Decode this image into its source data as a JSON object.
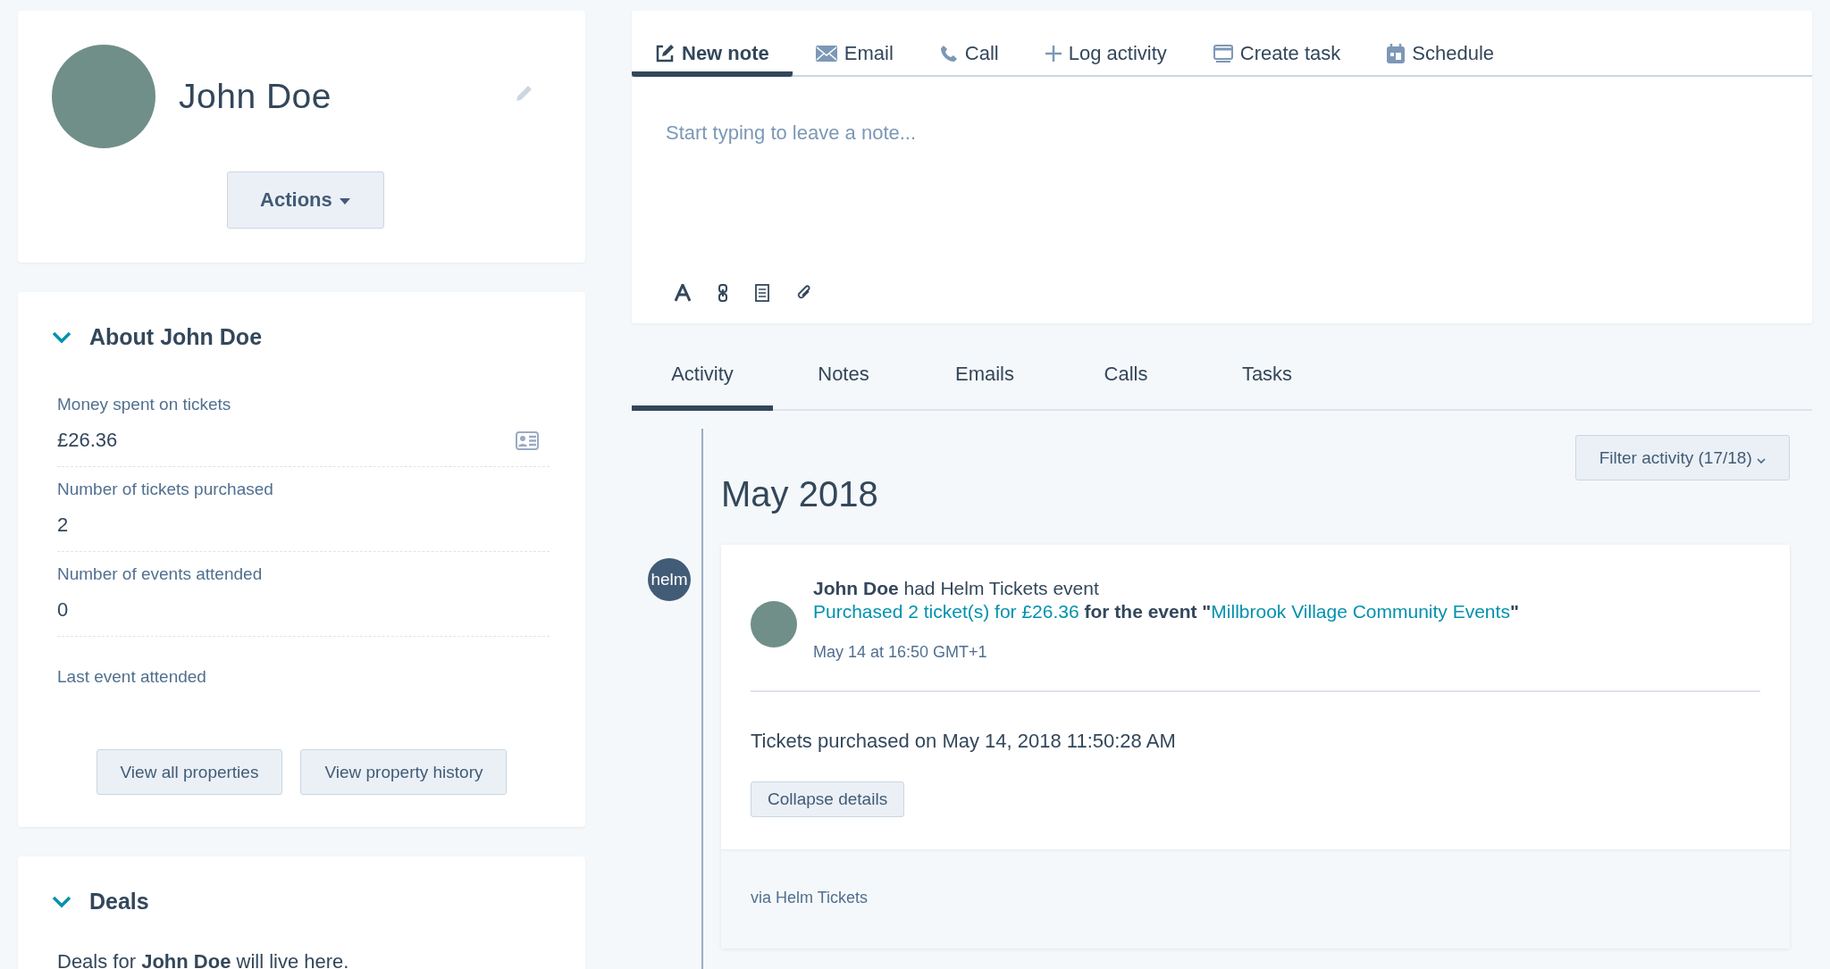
{
  "contact": {
    "name": "John Doe",
    "actions_button": "Actions"
  },
  "about": {
    "title": "About John Doe",
    "expanded": true,
    "properties": [
      {
        "label": "Money spent on tickets",
        "value": "£26.36"
      },
      {
        "label": "Number of tickets purchased",
        "value": "2"
      },
      {
        "label": "Number of events attended",
        "value": "0"
      },
      {
        "label": "Last event attended"
      }
    ],
    "buttons": [
      "View all properties",
      "View property history"
    ]
  },
  "deals": {
    "title": "Deals",
    "expanded": true,
    "text": "Deals for **John Doe** will live here."
  },
  "composer": {
    "tabs": [
      {
        "label": "New note",
        "selected": true
      },
      {
        "label": "Email",
        "selected": false
      },
      {
        "label": "Call",
        "selected": false
      },
      {
        "label": "Log activity",
        "selected": false
      },
      {
        "label": "Create task",
        "selected": false
      },
      {
        "label": "Schedule",
        "selected": false
      }
    ],
    "placeholder": "Start typing to leave a note..."
  },
  "activity_tabs": [
    {
      "label": "Activity",
      "selected": true
    },
    {
      "label": "Notes",
      "selected": false
    },
    {
      "label": "Emails",
      "selected": false
    },
    {
      "label": "Calls",
      "selected": false
    },
    {
      "label": "Tasks",
      "selected": false
    }
  ],
  "filter_button": "Filter activity (17/18)",
  "month": "May 2018",
  "event": {
    "badge": "helm",
    "headline": "**John Doe** had Helm Tickets event",
    "detail": [
      {
        "kind": "link",
        "text": "Purchased 2 ticket(s) for £26.36"
      },
      {
        "kind": "bold",
        "text": " for the event \""
      },
      {
        "kind": "link",
        "text": "Millbrook Village Community Events"
      },
      {
        "kind": "bold",
        "text": "\""
      }
    ],
    "timestamp": "May 14 at 16:50 GMT+1",
    "body": "Tickets purchased on May 14, 2018 11:50:28 AM",
    "collapse_button": "Collapse details",
    "source": "via Helm Tickets"
  }
}
